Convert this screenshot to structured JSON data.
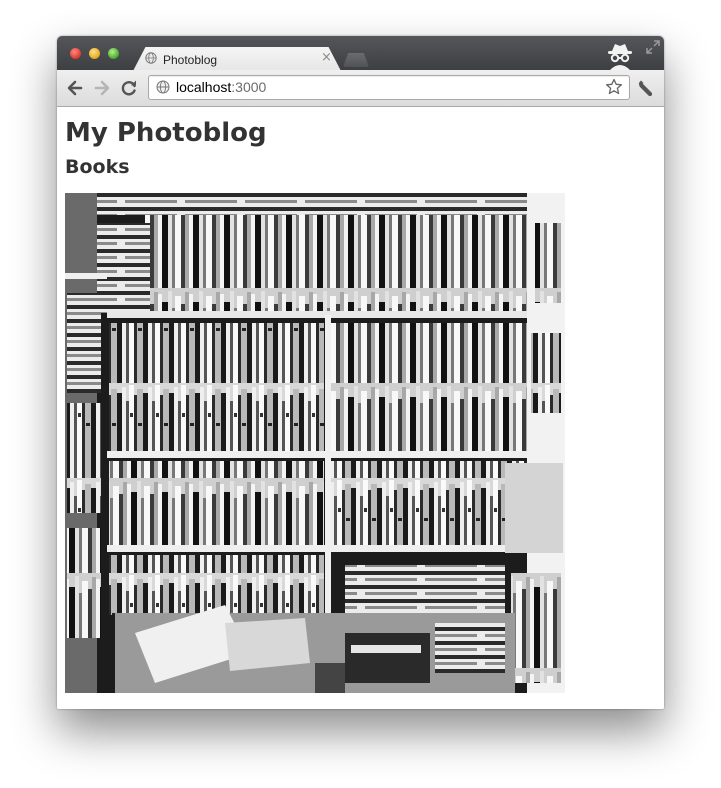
{
  "browser": {
    "tab_title": "Photoblog",
    "tab_close": "×",
    "url_host": "localhost",
    "url_port": ":3000"
  },
  "page": {
    "heading": "My Photoblog",
    "subheading": "Books",
    "photo_subject": "black-and-white photo of crowded bookshelves"
  },
  "icons": {
    "back": "back-arrow-icon",
    "forward": "forward-arrow-icon",
    "reload": "reload-icon",
    "globe": "globe-icon",
    "star": "star-icon",
    "wrench": "wrench-icon",
    "incognito": "incognito-icon"
  },
  "colors": {
    "close": "#e0443b",
    "minimize": "#e9b22a",
    "zoom": "#55b338",
    "heading_text": "#333333"
  }
}
